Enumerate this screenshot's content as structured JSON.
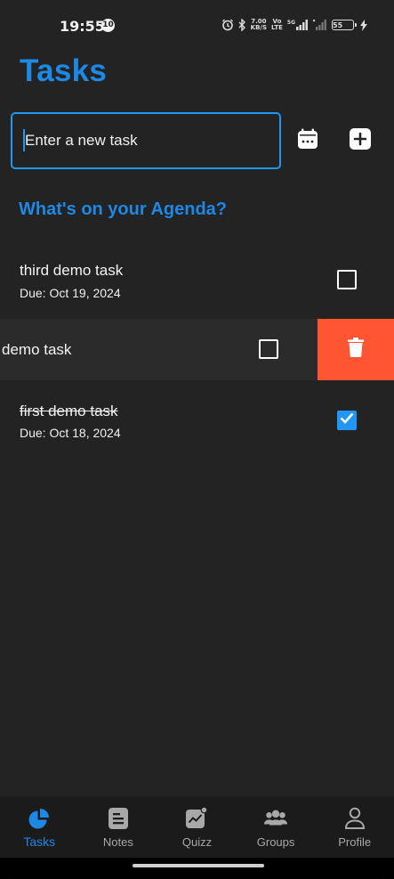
{
  "status_bar": {
    "time": "19:55",
    "notification_badge": "10",
    "network_speed_top": "7.00",
    "network_speed_unit": "KB/S",
    "volte_top": "Vo",
    "volte_bottom": "LTE",
    "network_type": "5G",
    "battery_level": "55"
  },
  "header": {
    "title": "Tasks"
  },
  "task_input": {
    "placeholder": "Enter a new task",
    "value": ""
  },
  "toolbar": {
    "calendar_icon": "calendar-icon",
    "add_icon": "plus-square-icon"
  },
  "section": {
    "heading": "What's on your Agenda?"
  },
  "tasks": [
    {
      "title": "third demo task",
      "due": "Due: Oct 19, 2024",
      "completed": false
    },
    {
      "title": "demo task",
      "due": "",
      "completed": false,
      "swiped": true
    },
    {
      "title": "first demo task",
      "due": "Due: Oct 18, 2024",
      "completed": true
    }
  ],
  "bottom_nav": {
    "items": [
      {
        "label": "Tasks",
        "icon": "pie-chart-icon",
        "active": true
      },
      {
        "label": "Notes",
        "icon": "notes-icon",
        "active": false
      },
      {
        "label": "Quizz",
        "icon": "chart-icon",
        "active": false
      },
      {
        "label": "Groups",
        "icon": "groups-icon",
        "active": false
      },
      {
        "label": "Profile",
        "icon": "profile-icon",
        "active": false
      }
    ]
  },
  "colors": {
    "accent": "#1e88e5",
    "background": "#232323",
    "delete": "#ff5533",
    "nav_background": "#1b1b1b"
  }
}
